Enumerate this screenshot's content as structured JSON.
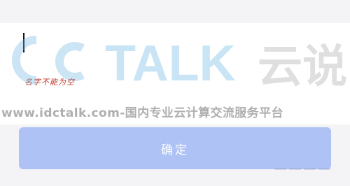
{
  "form": {
    "name_value": "",
    "error_hint": "名字不能为空",
    "confirm_label": "确定"
  },
  "watermark": {
    "logo_text_latin": "TALK",
    "logo_text_cn": "云说",
    "site_text": "www.idctalk.com-国内专业云计算交流服务平台"
  },
  "colors": {
    "background": "#f4f4f6",
    "card": "#ffffff",
    "button": "#aec2f6",
    "error": "#c0392b"
  }
}
